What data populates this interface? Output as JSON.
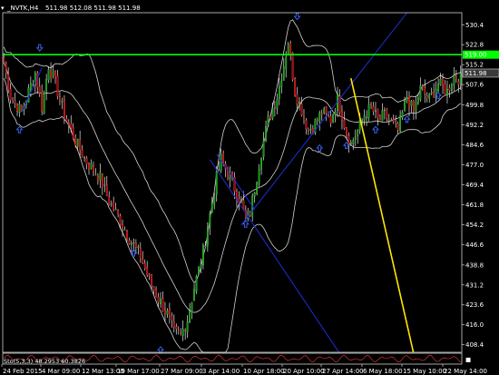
{
  "chart_data": {
    "type": "candlestick",
    "title": "_NVTK,H4",
    "ohlc_header": "511.98 512.08 511.98 511.98",
    "indicator_label": "Sto(5,3,3) 48.2953 60.3826",
    "ylim": [
      405.5,
      535.0
    ],
    "y_ticks": [
      530.4,
      522.8,
      515.2,
      507.6,
      499.8,
      492.2,
      484.6,
      477.0,
      469.4,
      461.8,
      454.2,
      446.6,
      438.8,
      431.2,
      423.6,
      416.0,
      408.4
    ],
    "x_ticks": [
      "24 Feb 2015",
      "4 Mar 09:00",
      "12 Mar 13:00",
      "19 Mar 17:00",
      "27 Mar 09:00",
      "3 Apr 14:00",
      "10 Apr 18:00",
      "20 Apr 10:00",
      "27 Apr 14:00",
      "6 May 18:00",
      "15 May 10:00",
      "22 May 14:00"
    ],
    "current_price": 511.98,
    "level_line": 519.0,
    "bollinger_window": 20,
    "bollinger_k": 2,
    "close_path": [
      [
        0,
        516
      ],
      [
        3,
        503
      ],
      [
        8,
        497
      ],
      [
        11,
        505
      ],
      [
        14,
        512
      ],
      [
        17,
        499
      ],
      [
        20,
        515
      ],
      [
        23,
        508
      ],
      [
        27,
        496
      ],
      [
        32,
        486
      ],
      [
        37,
        478
      ],
      [
        43,
        472
      ],
      [
        47,
        463
      ],
      [
        52,
        456
      ],
      [
        56,
        449
      ],
      [
        61,
        442
      ],
      [
        65,
        433
      ],
      [
        69,
        426
      ],
      [
        73,
        420
      ],
      [
        76,
        413
      ],
      [
        79,
        412
      ],
      [
        82,
        418
      ],
      [
        85,
        430
      ],
      [
        89,
        444
      ],
      [
        92,
        458
      ],
      [
        95,
        472
      ],
      [
        97,
        479
      ],
      [
        100,
        474
      ],
      [
        103,
        468
      ],
      [
        106,
        462
      ],
      [
        108,
        456
      ],
      [
        110,
        459
      ],
      [
        112,
        468
      ],
      [
        115,
        482
      ],
      [
        118,
        494
      ],
      [
        122,
        503
      ],
      [
        125,
        515
      ],
      [
        127,
        524
      ],
      [
        130,
        505
      ],
      [
        133,
        498
      ],
      [
        136,
        490
      ],
      [
        139,
        493
      ],
      [
        142,
        497
      ],
      [
        146,
        494
      ],
      [
        149,
        502
      ],
      [
        151,
        496
      ],
      [
        153,
        489
      ],
      [
        155,
        485
      ],
      [
        158,
        490
      ],
      [
        161,
        496
      ],
      [
        164,
        499
      ],
      [
        167,
        494
      ],
      [
        170,
        496
      ],
      [
        173,
        493
      ],
      [
        176,
        490
      ],
      [
        180,
        503
      ],
      [
        183,
        497
      ],
      [
        186,
        506
      ],
      [
        190,
        502
      ],
      [
        194,
        508
      ],
      [
        198,
        505
      ],
      [
        201,
        511
      ],
      [
        203,
        510
      ]
    ],
    "trend_lines": [
      {
        "color": "#1e2fd6",
        "from": [
          8,
          497
        ],
        "to": [
          17,
          514
        ]
      },
      {
        "color": "#1e2fd6",
        "from": [
          106,
          454
        ],
        "to": [
          180,
          535
        ]
      },
      {
        "color": "#1e2fd6",
        "from": [
          92,
          479
        ],
        "to": [
          150,
          405
        ]
      },
      {
        "color": "#1e2fd6",
        "from": [
          95,
          481
        ],
        "to": [
          112,
          460
        ]
      },
      {
        "color": "#ffe600",
        "from": [
          155,
          510
        ],
        "to": [
          183,
          405
        ]
      }
    ],
    "fractals_up": [
      [
        7,
        493
      ],
      [
        58,
        446
      ],
      [
        70,
        409
      ],
      [
        108,
        457
      ],
      [
        141,
        486
      ],
      [
        153,
        487
      ],
      [
        166,
        493
      ],
      [
        180,
        497
      ],
      [
        194,
        506
      ]
    ],
    "fractals_down": [
      [
        16,
        519
      ],
      [
        131,
        531
      ]
    ]
  },
  "colors": {
    "background": "#000000",
    "bull": "#00a000",
    "bear": "#b50000",
    "wick": "#e6e6e6",
    "bollinger": "#d2d2d2",
    "level": "#00ff00",
    "fractal": "#3b6bff",
    "price_box": "#3a3a3a",
    "indicator_line": "#ff3a3a"
  }
}
